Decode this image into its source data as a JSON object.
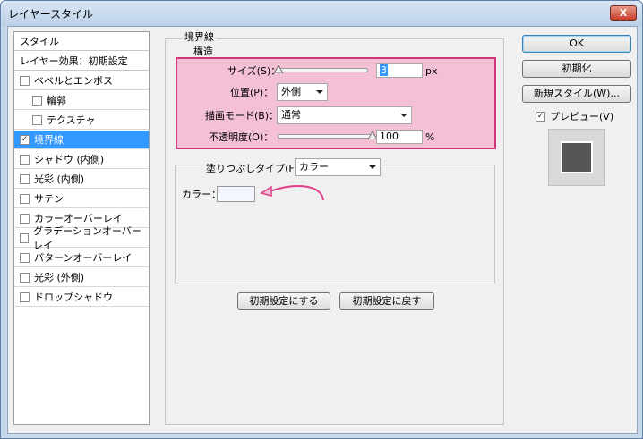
{
  "window": {
    "title": "レイヤースタイル",
    "close_label": "X"
  },
  "left_list": {
    "items": [
      {
        "label": "スタイル",
        "checkbox": false,
        "checked": false,
        "selected": false,
        "indent": false
      },
      {
        "label": "レイヤー効果：初期設定",
        "checkbox": false,
        "checked": false,
        "selected": false,
        "indent": false
      },
      {
        "label": "ベベルとエンボス",
        "checkbox": true,
        "checked": false,
        "selected": false,
        "indent": false
      },
      {
        "label": "輪郭",
        "checkbox": true,
        "checked": false,
        "selected": false,
        "indent": true
      },
      {
        "label": "テクスチャ",
        "checkbox": true,
        "checked": false,
        "selected": false,
        "indent": true
      },
      {
        "label": "境界線",
        "checkbox": true,
        "checked": true,
        "selected": true,
        "indent": false
      },
      {
        "label": "シャドウ (内側)",
        "checkbox": true,
        "checked": false,
        "selected": false,
        "indent": false
      },
      {
        "label": "光彩 (内側)",
        "checkbox": true,
        "checked": false,
        "selected": false,
        "indent": false
      },
      {
        "label": "サテン",
        "checkbox": true,
        "checked": false,
        "selected": false,
        "indent": false
      },
      {
        "label": "カラーオーバーレイ",
        "checkbox": true,
        "checked": false,
        "selected": false,
        "indent": false
      },
      {
        "label": "グラデーションオーバーレイ",
        "checkbox": true,
        "checked": false,
        "selected": false,
        "indent": false
      },
      {
        "label": "パターンオーバーレイ",
        "checkbox": true,
        "checked": false,
        "selected": false,
        "indent": false
      },
      {
        "label": "光彩 (外側)",
        "checkbox": true,
        "checked": false,
        "selected": false,
        "indent": false
      },
      {
        "label": "ドロップシャドウ",
        "checkbox": true,
        "checked": false,
        "selected": false,
        "indent": false
      }
    ]
  },
  "stroke": {
    "group_title": "境界線",
    "structure_title": "構造",
    "size": {
      "label": "サイズ(S)：",
      "value": "3",
      "unit": "px",
      "level_fraction": 0.01
    },
    "position": {
      "label": "位置(P)：",
      "value": "外側"
    },
    "blend_mode": {
      "label": "描画モード(B)：",
      "value": "通常"
    },
    "opacity": {
      "label": "不透明度(O)：",
      "value": "100",
      "unit": "%",
      "level_fraction": 1.0
    },
    "fill_type": {
      "label": "塗りつぶしタイプ(F)：",
      "value": "カラー"
    },
    "color": {
      "label": "カラー："
    },
    "make_default_label": "初期設定にする",
    "reset_default_label": "初期設定に戻す"
  },
  "actions": {
    "ok_label": "OK",
    "reset_label": "初期化",
    "new_style_label": "新規スタイル(W)...",
    "preview_label": "プレビュー(V)",
    "preview_checked": true
  },
  "colors": {
    "highlight_fill": "#f3c0d5",
    "highlight_border": "#d3357b",
    "selection": "#3399ff",
    "annotation_arrow": "#e0408a"
  }
}
